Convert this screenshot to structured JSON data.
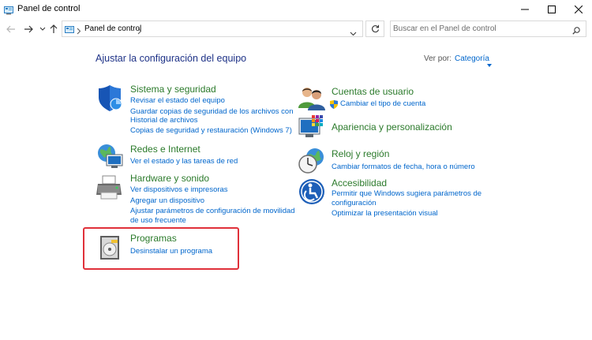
{
  "window": {
    "title": "Panel de control"
  },
  "address": {
    "path_item": "Panel de control"
  },
  "search": {
    "placeholder": "Buscar en el Panel de control"
  },
  "page": {
    "heading": "Ajustar la configuración del equipo"
  },
  "view_by": {
    "label": "Ver por:",
    "value": "Categoría"
  },
  "accent": {
    "title_green": "#2b7a2b",
    "link_blue": "#0066cc",
    "heading_blue": "#1e3287",
    "highlight_red": "#e0313a"
  },
  "categories_left": [
    {
      "title": "Sistema y seguridad",
      "icon": "shield-icon",
      "links": [
        "Revisar el estado del equipo",
        "Guardar copias de seguridad de los archivos con",
        "Historial de archivos",
        "Copias de seguridad y restauración (Windows 7)"
      ]
    },
    {
      "title": "Redes e Internet",
      "icon": "network-globe-icon",
      "links": [
        "Ver el estado y las tareas de red"
      ]
    },
    {
      "title": "Hardware y sonido",
      "icon": "printer-icon",
      "links": [
        "Ver dispositivos e impresoras",
        "Agregar un dispositivo",
        "Ajustar parámetros de configuración de movilidad",
        "de uso frecuente"
      ]
    },
    {
      "title": "Programas",
      "icon": "programs-disc-icon",
      "links": [
        "Desinstalar un programa"
      ]
    }
  ],
  "categories_right": [
    {
      "title": "Cuentas de usuario",
      "icon": "users-icon",
      "links": [
        "Cambiar el tipo de cuenta"
      ]
    },
    {
      "title": "Apariencia y personalización",
      "icon": "monitor-palette-icon",
      "links": []
    },
    {
      "title": "Reloj y región",
      "icon": "clock-globe-icon",
      "links": [
        "Cambiar formatos de fecha, hora o número"
      ]
    },
    {
      "title": "Accesibilidad",
      "icon": "accessibility-icon",
      "links": [
        "Permitir que Windows sugiera parámetros de",
        "configuración",
        "Optimizar la presentación visual"
      ]
    }
  ]
}
